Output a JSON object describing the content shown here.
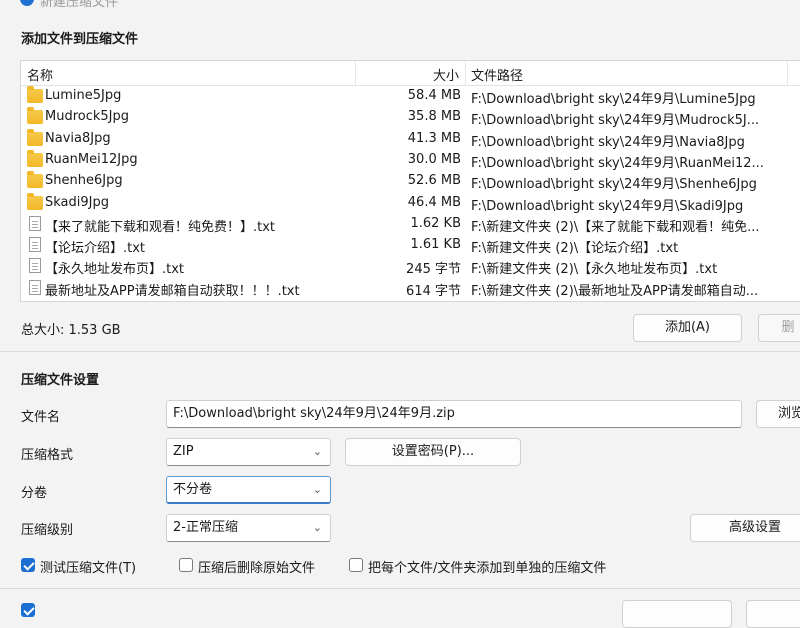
{
  "window": {
    "title": "新建压缩文件"
  },
  "files_section": {
    "title": "添加文件到压缩文件",
    "columns": {
      "name": "名称",
      "size": "大小",
      "path": "文件路径"
    },
    "rows": [
      {
        "type": "folder",
        "name": "Lumine5Jpg",
        "size": "58.4 MB",
        "path": "F:\\Download\\bright sky\\24年9月\\Lumine5Jpg"
      },
      {
        "type": "folder",
        "name": "Mudrock5Jpg",
        "size": "35.8 MB",
        "path": "F:\\Download\\bright sky\\24年9月\\Mudrock5J..."
      },
      {
        "type": "folder",
        "name": "Navia8Jpg",
        "size": "41.3 MB",
        "path": "F:\\Download\\bright sky\\24年9月\\Navia8Jpg"
      },
      {
        "type": "folder",
        "name": "RuanMei12Jpg",
        "size": "30.0 MB",
        "path": "F:\\Download\\bright sky\\24年9月\\RuanMei12..."
      },
      {
        "type": "folder",
        "name": "Shenhe6Jpg",
        "size": "52.6 MB",
        "path": "F:\\Download\\bright sky\\24年9月\\Shenhe6Jpg"
      },
      {
        "type": "folder",
        "name": "Skadi9Jpg",
        "size": "46.4 MB",
        "path": "F:\\Download\\bright sky\\24年9月\\Skadi9Jpg"
      },
      {
        "type": "file",
        "name": "【来了就能下载和观看！纯免费！】.txt",
        "size": "1.62 KB",
        "path": "F:\\新建文件夹 (2)\\【来了就能下载和观看！纯免..."
      },
      {
        "type": "file",
        "name": "【论坛介绍】.txt",
        "size": "1.61 KB",
        "path": "F:\\新建文件夹 (2)\\【论坛介绍】.txt"
      },
      {
        "type": "file",
        "name": "【永久地址发布页】.txt",
        "size": "245 字节",
        "path": "F:\\新建文件夹 (2)\\【永久地址发布页】.txt"
      },
      {
        "type": "file",
        "name": "最新地址及APP请发邮箱自动获取！！！.txt",
        "size": "614 字节",
        "path": "F:\\新建文件夹 (2)\\最新地址及APP请发邮箱自动..."
      }
    ],
    "total_size": "总大小: 1.53 GB",
    "add_button": "添加(A)",
    "delete_button": "删"
  },
  "settings_section": {
    "title": "压缩文件设置",
    "filename_label": "文件名",
    "filename_value": "F:\\Download\\bright sky\\24年9月\\24年9月.zip",
    "browse_button": "浏览",
    "format_label": "压缩格式",
    "format_value": "ZIP",
    "password_button": "设置密码(P)...",
    "split_label": "分卷",
    "split_value": "不分卷",
    "level_label": "压缩级别",
    "level_value": "2-正常压缩",
    "advanced_button": "高级设置",
    "options": {
      "test": {
        "label": "测试压缩文件(T)",
        "checked": true
      },
      "delete_after": {
        "label": "压缩后删除原始文件",
        "checked": false
      },
      "separate": {
        "label": "把每个文件/文件夹添加到单独的压缩文件",
        "checked": false
      }
    }
  },
  "colors": {
    "accent": "#1a6fd1",
    "folder": "#f3b827"
  }
}
